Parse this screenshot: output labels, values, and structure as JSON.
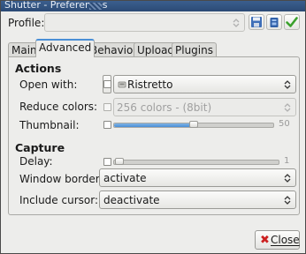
{
  "window": {
    "title": "Shutter - Preferences"
  },
  "profile": {
    "label": "Profile:",
    "value": ""
  },
  "toolbar": {
    "icons": [
      "save-icon",
      "delete-icon",
      "apply-icon"
    ]
  },
  "tabs": [
    {
      "label": "Main"
    },
    {
      "label": "Advanced",
      "active": true
    },
    {
      "label": "Behavior"
    },
    {
      "label": "Upload"
    },
    {
      "label": "Plugins"
    }
  ],
  "actions": {
    "heading": "Actions",
    "open_with": {
      "label": "Open with:",
      "app": "Ristretto"
    },
    "reduce_colors": {
      "label": "Reduce colors:",
      "value": "256 colors  - (8bit)"
    },
    "thumbnail": {
      "label": "Thumbnail:",
      "value": "50"
    }
  },
  "capture": {
    "heading": "Capture",
    "delay": {
      "label": "Delay:",
      "value": "1"
    },
    "window_border": {
      "label": "Window border:",
      "value": "activate"
    },
    "include_cursor": {
      "label": "Include cursor:",
      "value": "deactivate"
    }
  },
  "footer": {
    "close_label": "Close"
  },
  "colors": {
    "accent": "#4a8fd6",
    "titlebar": "#2b4a75",
    "close_icon": "#cc2020",
    "apply_icon": "#3aa12c"
  }
}
